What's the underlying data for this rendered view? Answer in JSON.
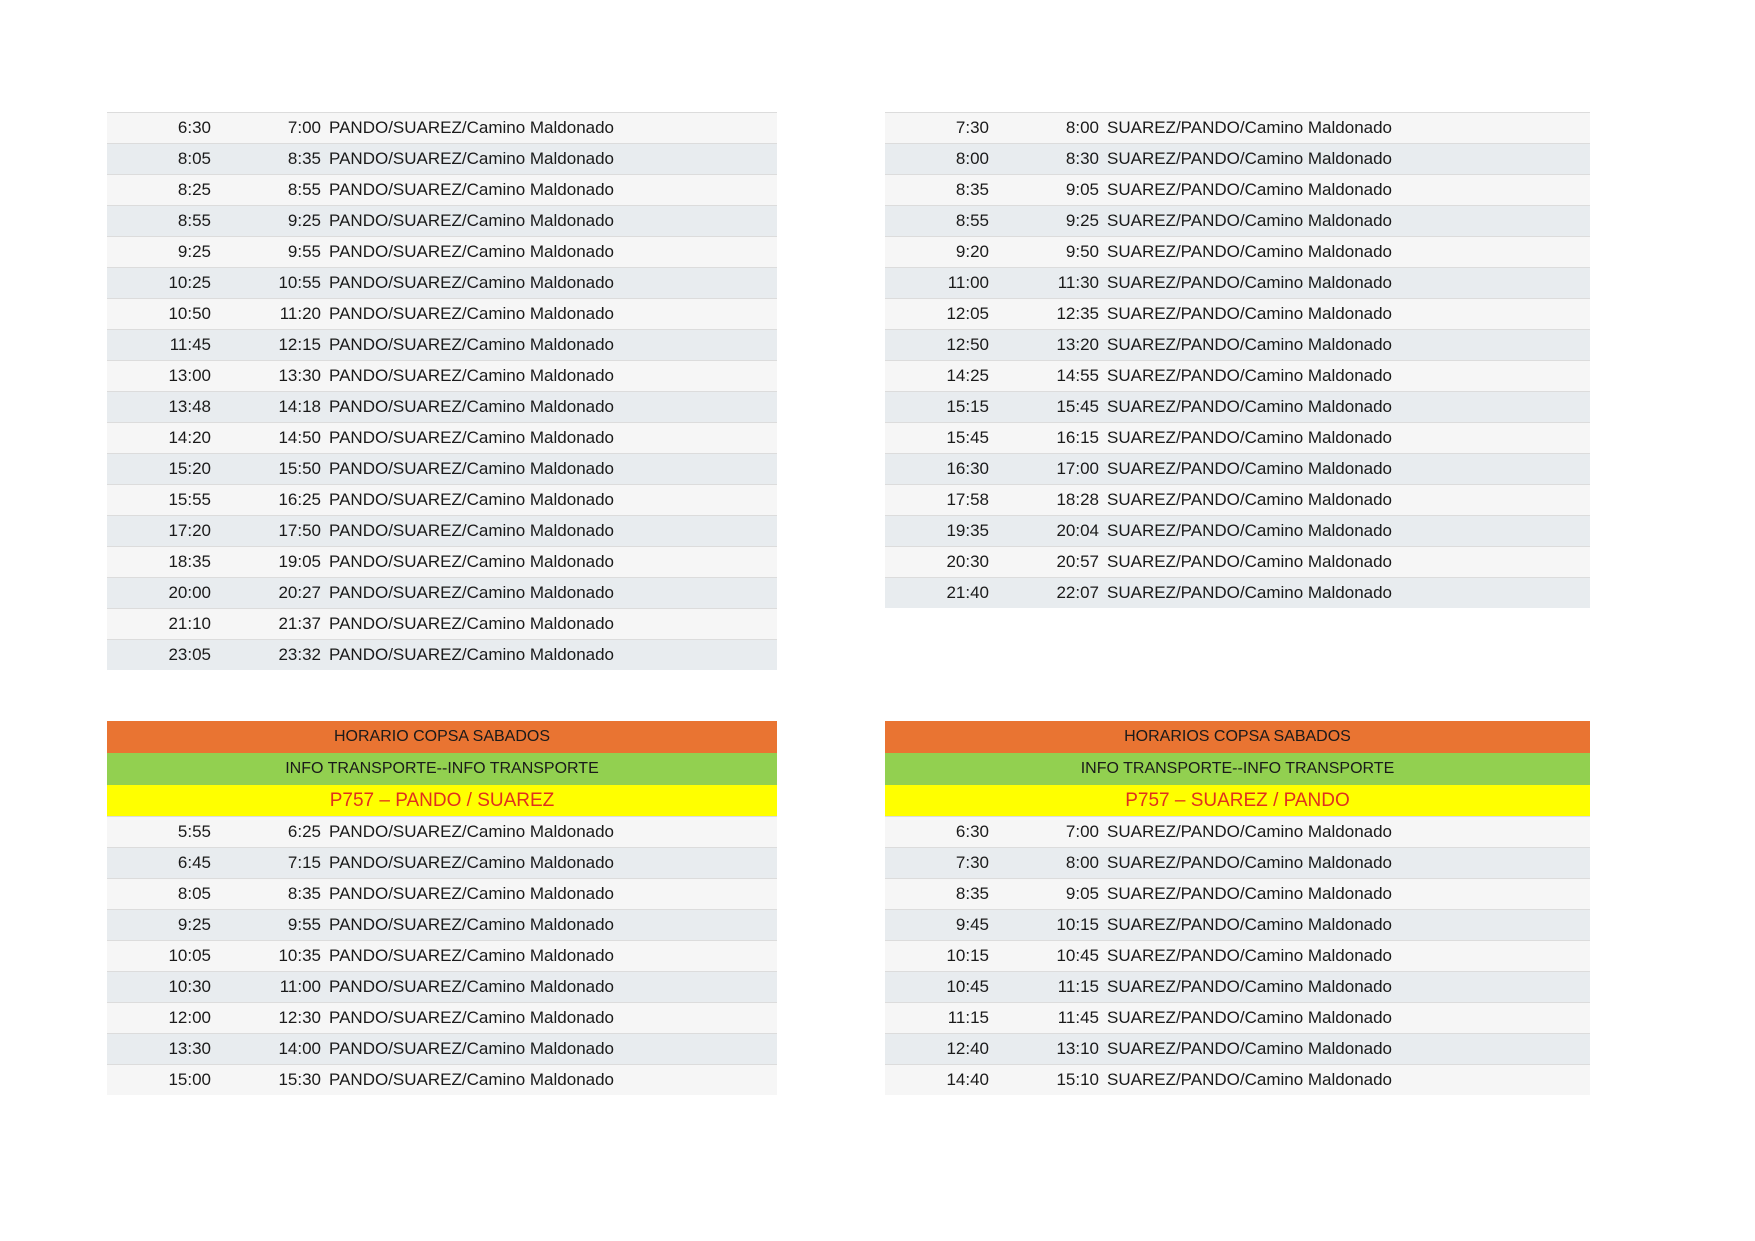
{
  "weekday_pando_suarez": [
    [
      "6:30",
      "7:00",
      "PANDO/SUAREZ/Camino Maldonado"
    ],
    [
      "8:05",
      "8:35",
      "PANDO/SUAREZ/Camino Maldonado"
    ],
    [
      "8:25",
      "8:55",
      "PANDO/SUAREZ/Camino Maldonado"
    ],
    [
      "8:55",
      "9:25",
      "PANDO/SUAREZ/Camino Maldonado"
    ],
    [
      "9:25",
      "9:55",
      "PANDO/SUAREZ/Camino Maldonado"
    ],
    [
      "10:25",
      "10:55",
      "PANDO/SUAREZ/Camino Maldonado"
    ],
    [
      "10:50",
      "11:20",
      "PANDO/SUAREZ/Camino Maldonado"
    ],
    [
      "11:45",
      "12:15",
      "PANDO/SUAREZ/Camino Maldonado"
    ],
    [
      "13:00",
      "13:30",
      "PANDO/SUAREZ/Camino Maldonado"
    ],
    [
      "13:48",
      "14:18",
      "PANDO/SUAREZ/Camino Maldonado"
    ],
    [
      "14:20",
      "14:50",
      "PANDO/SUAREZ/Camino Maldonado"
    ],
    [
      "15:20",
      "15:50",
      "PANDO/SUAREZ/Camino Maldonado"
    ],
    [
      "15:55",
      "16:25",
      "PANDO/SUAREZ/Camino Maldonado"
    ],
    [
      "17:20",
      "17:50",
      "PANDO/SUAREZ/Camino Maldonado"
    ],
    [
      "18:35",
      "19:05",
      "PANDO/SUAREZ/Camino Maldonado"
    ],
    [
      "20:00",
      "20:27",
      "PANDO/SUAREZ/Camino Maldonado"
    ],
    [
      "21:10",
      "21:37",
      "PANDO/SUAREZ/Camino Maldonado"
    ],
    [
      "23:05",
      "23:32",
      "PANDO/SUAREZ/Camino Maldonado"
    ]
  ],
  "weekday_suarez_pando": [
    [
      "7:30",
      "8:00",
      "SUAREZ/PANDO/Camino Maldonado"
    ],
    [
      "8:00",
      "8:30",
      "SUAREZ/PANDO/Camino Maldonado"
    ],
    [
      "8:35",
      "9:05",
      "SUAREZ/PANDO/Camino Maldonado"
    ],
    [
      "8:55",
      "9:25",
      "SUAREZ/PANDO/Camino Maldonado"
    ],
    [
      "9:20",
      "9:50",
      "SUAREZ/PANDO/Camino Maldonado"
    ],
    [
      "11:00",
      "11:30",
      "SUAREZ/PANDO/Camino Maldonado"
    ],
    [
      "12:05",
      "12:35",
      "SUAREZ/PANDO/Camino Maldonado"
    ],
    [
      "12:50",
      "13:20",
      "SUAREZ/PANDO/Camino Maldonado"
    ],
    [
      "14:25",
      "14:55",
      "SUAREZ/PANDO/Camino Maldonado"
    ],
    [
      "15:15",
      "15:45",
      "SUAREZ/PANDO/Camino Maldonado"
    ],
    [
      "15:45",
      "16:15",
      "SUAREZ/PANDO/Camino Maldonado"
    ],
    [
      "16:30",
      "17:00",
      "SUAREZ/PANDO/Camino Maldonado"
    ],
    [
      "17:58",
      "18:28",
      "SUAREZ/PANDO/Camino Maldonado"
    ],
    [
      "19:35",
      "20:04",
      "SUAREZ/PANDO/Camino Maldonado"
    ],
    [
      "20:30",
      "20:57",
      "SUAREZ/PANDO/Camino Maldonado"
    ],
    [
      "21:40",
      "22:07",
      "SUAREZ/PANDO/Camino Maldonado"
    ]
  ],
  "saturday_left": {
    "title": "HORARIO COPSA SABADOS",
    "info": "INFO TRANSPORTE--INFO TRANSPORTE",
    "line": "P757 – PANDO / SUAREZ",
    "rows": [
      [
        "5:55",
        "6:25",
        "PANDO/SUAREZ/Camino Maldonado"
      ],
      [
        "6:45",
        "7:15",
        "PANDO/SUAREZ/Camino Maldonado"
      ],
      [
        "8:05",
        "8:35",
        "PANDO/SUAREZ/Camino Maldonado"
      ],
      [
        "9:25",
        "9:55",
        "PANDO/SUAREZ/Camino Maldonado"
      ],
      [
        "10:05",
        "10:35",
        "PANDO/SUAREZ/Camino Maldonado"
      ],
      [
        "10:30",
        "11:00",
        "PANDO/SUAREZ/Camino Maldonado"
      ],
      [
        "12:00",
        "12:30",
        "PANDO/SUAREZ/Camino Maldonado"
      ],
      [
        "13:30",
        "14:00",
        "PANDO/SUAREZ/Camino Maldonado"
      ],
      [
        "15:00",
        "15:30",
        "PANDO/SUAREZ/Camino Maldonado"
      ]
    ]
  },
  "saturday_right": {
    "title": "HORARIOS COPSA SABADOS",
    "info": "INFO TRANSPORTE--INFO TRANSPORTE",
    "line": "P757 – SUAREZ / PANDO",
    "rows": [
      [
        "6:30",
        "7:00",
        "SUAREZ/PANDO/Camino Maldonado"
      ],
      [
        "7:30",
        "8:00",
        "SUAREZ/PANDO/Camino Maldonado"
      ],
      [
        "8:35",
        "9:05",
        "SUAREZ/PANDO/Camino Maldonado"
      ],
      [
        "9:45",
        "10:15",
        "SUAREZ/PANDO/Camino Maldonado"
      ],
      [
        "10:15",
        "10:45",
        "SUAREZ/PANDO/Camino Maldonado"
      ],
      [
        "10:45",
        "11:15",
        "SUAREZ/PANDO/Camino Maldonado"
      ],
      [
        "11:15",
        "11:45",
        "SUAREZ/PANDO/Camino Maldonado"
      ],
      [
        "12:40",
        "13:10",
        "SUAREZ/PANDO/Camino Maldonado"
      ],
      [
        "14:40",
        "15:10",
        "SUAREZ/PANDO/Camino Maldonado"
      ]
    ]
  }
}
